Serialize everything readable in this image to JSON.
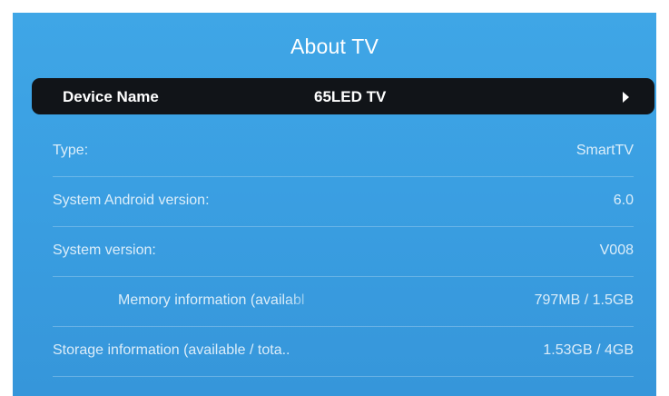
{
  "screen": {
    "title": "About TV"
  },
  "device": {
    "label": "Device Name",
    "value": "65LED TV",
    "arrow_icon": "chevron-right-icon"
  },
  "info": {
    "type": {
      "label": "Type:",
      "value": "SmartTV"
    },
    "android": {
      "label": "System Android version:",
      "value": "6.0"
    },
    "system": {
      "label": "System version:",
      "value": "V008"
    },
    "memory": {
      "label": "Memory information (availabl",
      "value": "797MB / 1.5GB"
    },
    "storage": {
      "label": "Storage information (available / tota..",
      "value": "1.53GB / 4GB"
    }
  },
  "colors": {
    "background": "#3a9fe2",
    "selected_row": "#111418",
    "text": "#ffffff"
  }
}
